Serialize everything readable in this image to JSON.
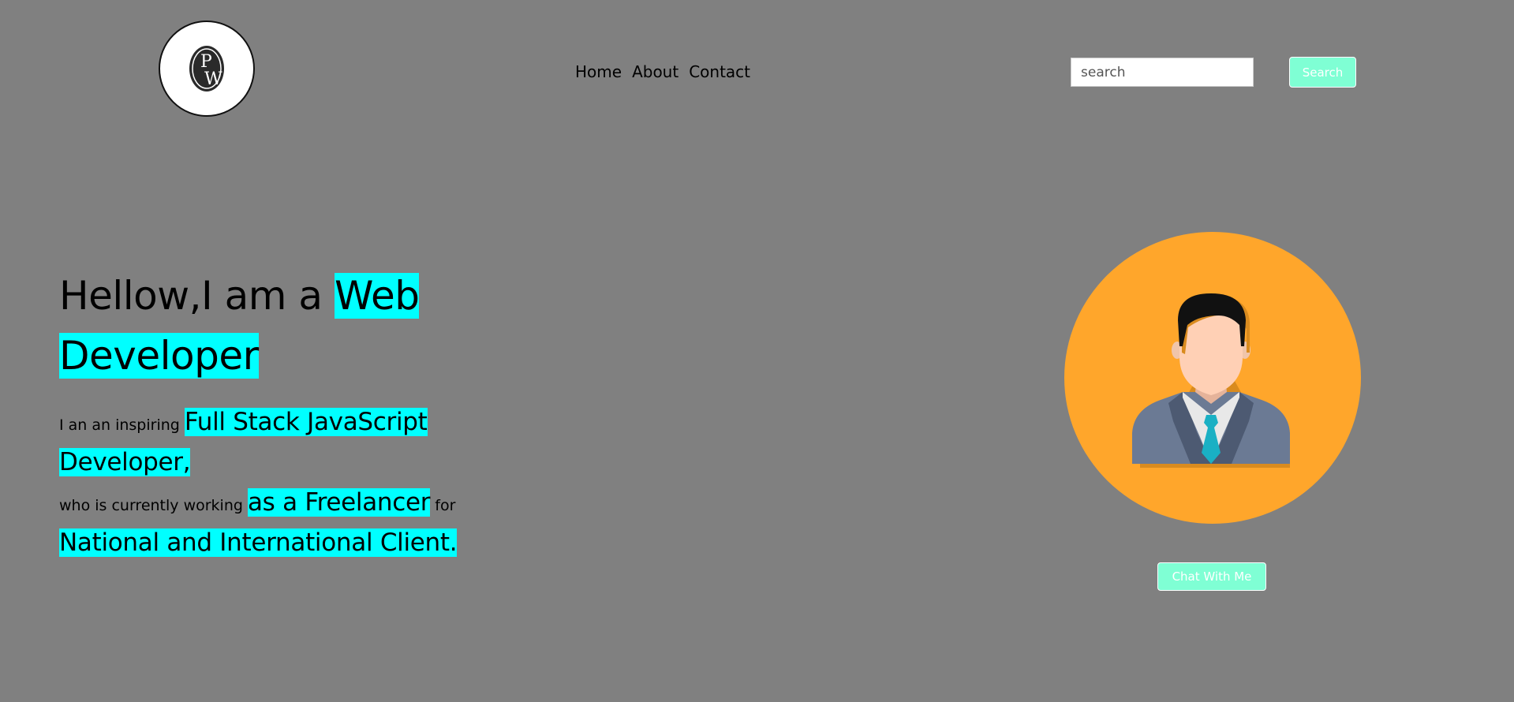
{
  "header": {
    "logo_text": "PW",
    "nav": [
      {
        "label": "Home"
      },
      {
        "label": "About"
      },
      {
        "label": "Contact"
      }
    ],
    "search": {
      "placeholder": "search",
      "value": "",
      "button_label": "Search"
    }
  },
  "hero": {
    "title_prefix": "Hellow,I am a ",
    "title_highlight": "Web Developer",
    "desc_part1": "I an an inspiring ",
    "desc_highlight1": "Full Stack JavaScript Developer,",
    "desc_part2": "who is currently working ",
    "desc_highlight2": "as a Freelancer",
    "desc_part3": " for",
    "desc_highlight3": "National and International Client."
  },
  "avatar": {
    "icon": "businessman-avatar-icon",
    "chat_button_label": "Chat With Me"
  },
  "colors": {
    "background": "#808080",
    "highlight": "#00ffff",
    "button": "#7fffd4",
    "avatar_circle": "#ffa62b"
  }
}
